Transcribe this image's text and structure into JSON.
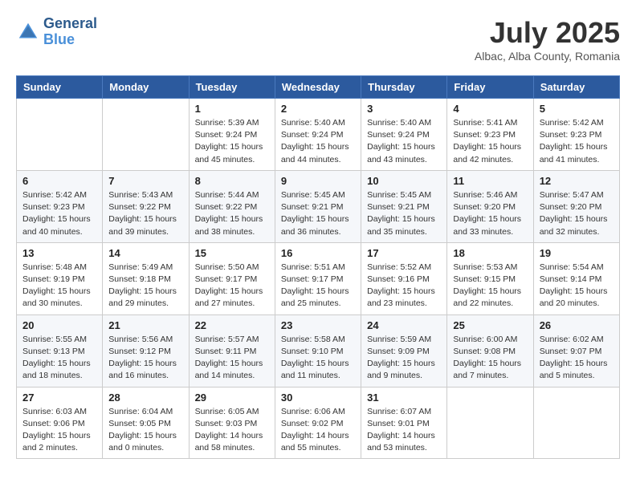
{
  "logo": {
    "text_general": "General",
    "text_blue": "Blue"
  },
  "title": "July 2025",
  "location": "Albac, Alba County, Romania",
  "days_of_week": [
    "Sunday",
    "Monday",
    "Tuesday",
    "Wednesday",
    "Thursday",
    "Friday",
    "Saturday"
  ],
  "weeks": [
    [
      {
        "day": "",
        "info": ""
      },
      {
        "day": "",
        "info": ""
      },
      {
        "day": "1",
        "info": "Sunrise: 5:39 AM\nSunset: 9:24 PM\nDaylight: 15 hours and 45 minutes."
      },
      {
        "day": "2",
        "info": "Sunrise: 5:40 AM\nSunset: 9:24 PM\nDaylight: 15 hours and 44 minutes."
      },
      {
        "day": "3",
        "info": "Sunrise: 5:40 AM\nSunset: 9:24 PM\nDaylight: 15 hours and 43 minutes."
      },
      {
        "day": "4",
        "info": "Sunrise: 5:41 AM\nSunset: 9:23 PM\nDaylight: 15 hours and 42 minutes."
      },
      {
        "day": "5",
        "info": "Sunrise: 5:42 AM\nSunset: 9:23 PM\nDaylight: 15 hours and 41 minutes."
      }
    ],
    [
      {
        "day": "6",
        "info": "Sunrise: 5:42 AM\nSunset: 9:23 PM\nDaylight: 15 hours and 40 minutes."
      },
      {
        "day": "7",
        "info": "Sunrise: 5:43 AM\nSunset: 9:22 PM\nDaylight: 15 hours and 39 minutes."
      },
      {
        "day": "8",
        "info": "Sunrise: 5:44 AM\nSunset: 9:22 PM\nDaylight: 15 hours and 38 minutes."
      },
      {
        "day": "9",
        "info": "Sunrise: 5:45 AM\nSunset: 9:21 PM\nDaylight: 15 hours and 36 minutes."
      },
      {
        "day": "10",
        "info": "Sunrise: 5:45 AM\nSunset: 9:21 PM\nDaylight: 15 hours and 35 minutes."
      },
      {
        "day": "11",
        "info": "Sunrise: 5:46 AM\nSunset: 9:20 PM\nDaylight: 15 hours and 33 minutes."
      },
      {
        "day": "12",
        "info": "Sunrise: 5:47 AM\nSunset: 9:20 PM\nDaylight: 15 hours and 32 minutes."
      }
    ],
    [
      {
        "day": "13",
        "info": "Sunrise: 5:48 AM\nSunset: 9:19 PM\nDaylight: 15 hours and 30 minutes."
      },
      {
        "day": "14",
        "info": "Sunrise: 5:49 AM\nSunset: 9:18 PM\nDaylight: 15 hours and 29 minutes."
      },
      {
        "day": "15",
        "info": "Sunrise: 5:50 AM\nSunset: 9:17 PM\nDaylight: 15 hours and 27 minutes."
      },
      {
        "day": "16",
        "info": "Sunrise: 5:51 AM\nSunset: 9:17 PM\nDaylight: 15 hours and 25 minutes."
      },
      {
        "day": "17",
        "info": "Sunrise: 5:52 AM\nSunset: 9:16 PM\nDaylight: 15 hours and 23 minutes."
      },
      {
        "day": "18",
        "info": "Sunrise: 5:53 AM\nSunset: 9:15 PM\nDaylight: 15 hours and 22 minutes."
      },
      {
        "day": "19",
        "info": "Sunrise: 5:54 AM\nSunset: 9:14 PM\nDaylight: 15 hours and 20 minutes."
      }
    ],
    [
      {
        "day": "20",
        "info": "Sunrise: 5:55 AM\nSunset: 9:13 PM\nDaylight: 15 hours and 18 minutes."
      },
      {
        "day": "21",
        "info": "Sunrise: 5:56 AM\nSunset: 9:12 PM\nDaylight: 15 hours and 16 minutes."
      },
      {
        "day": "22",
        "info": "Sunrise: 5:57 AM\nSunset: 9:11 PM\nDaylight: 15 hours and 14 minutes."
      },
      {
        "day": "23",
        "info": "Sunrise: 5:58 AM\nSunset: 9:10 PM\nDaylight: 15 hours and 11 minutes."
      },
      {
        "day": "24",
        "info": "Sunrise: 5:59 AM\nSunset: 9:09 PM\nDaylight: 15 hours and 9 minutes."
      },
      {
        "day": "25",
        "info": "Sunrise: 6:00 AM\nSunset: 9:08 PM\nDaylight: 15 hours and 7 minutes."
      },
      {
        "day": "26",
        "info": "Sunrise: 6:02 AM\nSunset: 9:07 PM\nDaylight: 15 hours and 5 minutes."
      }
    ],
    [
      {
        "day": "27",
        "info": "Sunrise: 6:03 AM\nSunset: 9:06 PM\nDaylight: 15 hours and 2 minutes."
      },
      {
        "day": "28",
        "info": "Sunrise: 6:04 AM\nSunset: 9:05 PM\nDaylight: 15 hours and 0 minutes."
      },
      {
        "day": "29",
        "info": "Sunrise: 6:05 AM\nSunset: 9:03 PM\nDaylight: 14 hours and 58 minutes."
      },
      {
        "day": "30",
        "info": "Sunrise: 6:06 AM\nSunset: 9:02 PM\nDaylight: 14 hours and 55 minutes."
      },
      {
        "day": "31",
        "info": "Sunrise: 6:07 AM\nSunset: 9:01 PM\nDaylight: 14 hours and 53 minutes."
      },
      {
        "day": "",
        "info": ""
      },
      {
        "day": "",
        "info": ""
      }
    ]
  ]
}
